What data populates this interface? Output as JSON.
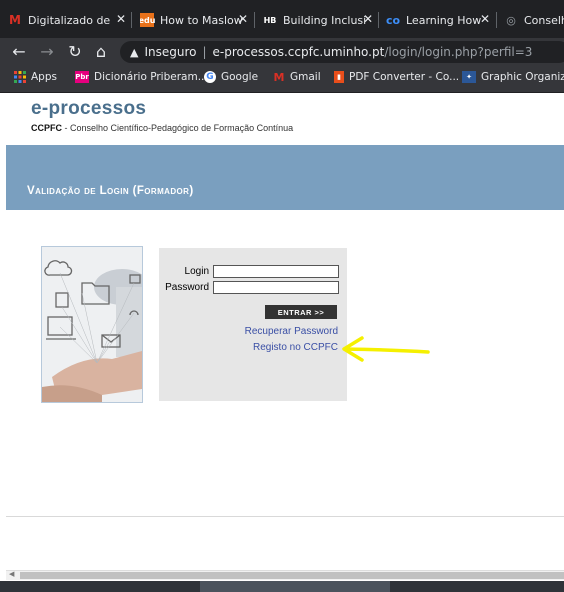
{
  "browser": {
    "tabs": [
      {
        "label": "Digitalizado de",
        "icon": "gmail-icon",
        "color": "#d93025"
      },
      {
        "label": "How to Maslow",
        "icon": "edu-icon",
        "color": "#e8711a"
      },
      {
        "label": "Building Inclusi",
        "icon": "hb-icon",
        "color": "#ffffff"
      },
      {
        "label": "Learning How",
        "icon": "coursera-icon",
        "color": "#3d8ef7"
      },
      {
        "label": "Conselho",
        "icon": "globe-icon",
        "color": "#9aa0a6"
      }
    ],
    "address": {
      "security": "Inseguro",
      "host": "e-processos.ccpfc.uminho.pt",
      "path": "/login/login.php?perfil=3"
    },
    "bookmarks": [
      {
        "label": "Apps",
        "icon": "apps-icon"
      },
      {
        "label": "Dicionário Priberam...",
        "icon": "priberam-icon"
      },
      {
        "label": "Google",
        "icon": "google-icon"
      },
      {
        "label": "Gmail",
        "icon": "gmail-icon"
      },
      {
        "label": "PDF Converter - Co...",
        "icon": "pdf-icon"
      },
      {
        "label": "Graphic Organizer",
        "icon": "graphic-organizer-icon"
      }
    ]
  },
  "site": {
    "logo": "e-processos",
    "subtitle_bold": "CCPFC",
    "subtitle_rest": " - Conselho Científico-Pedagógico de Formação Contínua",
    "banner_title": "Validação de Login (Formador)",
    "login_label": "Login",
    "password_label": "Password",
    "login_value": "",
    "password_value": "",
    "submit_label": "ENTRAR >>",
    "recover_link": "Recuperar Password",
    "register_link": "Registo no CCPFC"
  },
  "annotation": {
    "color": "#f5f000"
  }
}
